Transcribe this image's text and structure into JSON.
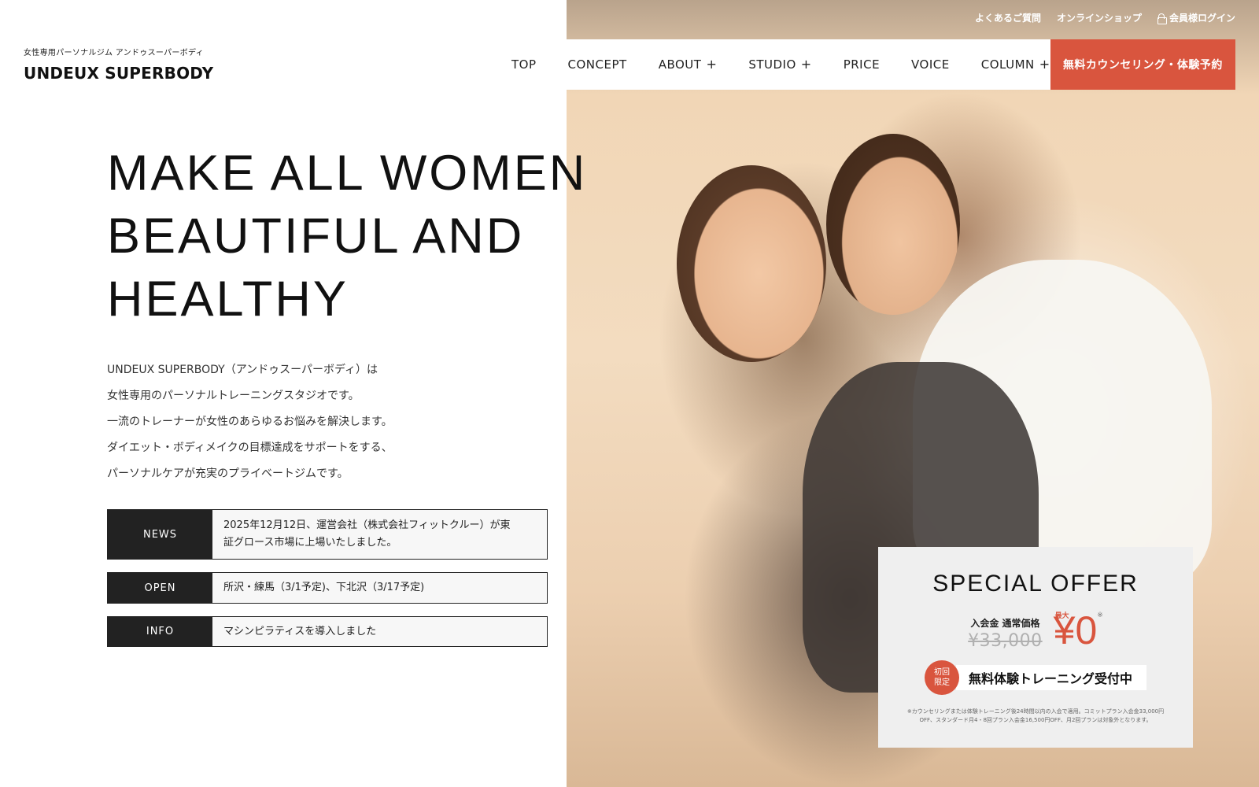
{
  "utility": {
    "faq": "よくあるご質問",
    "shop": "オンラインショップ",
    "login": "会員様ログイン"
  },
  "logo": {
    "tagline": "女性専用パーソナルジム アンドゥスーパーボディ",
    "name": "UNDEUX SUPERBODY"
  },
  "nav": {
    "top": "TOP",
    "concept": "CONCEPT",
    "about": "ABOUT",
    "studio": "STUDIO",
    "price": "PRICE",
    "voice": "VOICE",
    "column": "COLUMN",
    "plus": "+",
    "cta": "無料カウンセリング・体験予約"
  },
  "hero": {
    "headline": [
      "MAKE ALL WOMEN",
      "BEAUTIFUL AND",
      "HEALTHY"
    ],
    "intro": [
      "UNDEUX SUPERBODY（アンドゥスーパーボディ）は",
      "女性専用のパーソナルトレーニングスタジオです。",
      "一流のトレーナーが女性のあらゆるお悩みを解決します。",
      "ダイエット・ボディメイクの目標達成をサポートをする、",
      "パーソナルケアが充実のプライベートジムです。"
    ]
  },
  "notices": {
    "news": {
      "label": "NEWS",
      "line1": "2025年12月12日、運営会社（株式会社フィットクルー）が東",
      "line2": "証グロース市場に上場いたしました。"
    },
    "open": {
      "label": "OPEN",
      "text": "所沢・練馬（3/1予定)、下北沢（3/17予定)"
    },
    "info": {
      "label": "INFO",
      "text": "マシンピラティスを導入しました"
    }
  },
  "offer": {
    "title": "SPECIAL OFFER",
    "label": "入会金 通常価格",
    "old_price": "¥33,000",
    "max": "最大",
    "new_price": "¥0",
    "note_mark": "※",
    "badge_line1": "初回",
    "badge_line2": "限定",
    "trial": "無料体験トレーニング受付中",
    "disclaimer_line1": "※カウンセリングまたは体験トレーニング後24時間以内の入会で適用。コミットプラン入会金33,000円",
    "disclaimer_line2": "OFF、スタンダード月4・8回プラン入会金16,500円OFF、月2回プランは対象外となります。"
  },
  "colors": {
    "accent": "#d9553e",
    "dark": "#222222",
    "offer_bg": "#efefef"
  }
}
